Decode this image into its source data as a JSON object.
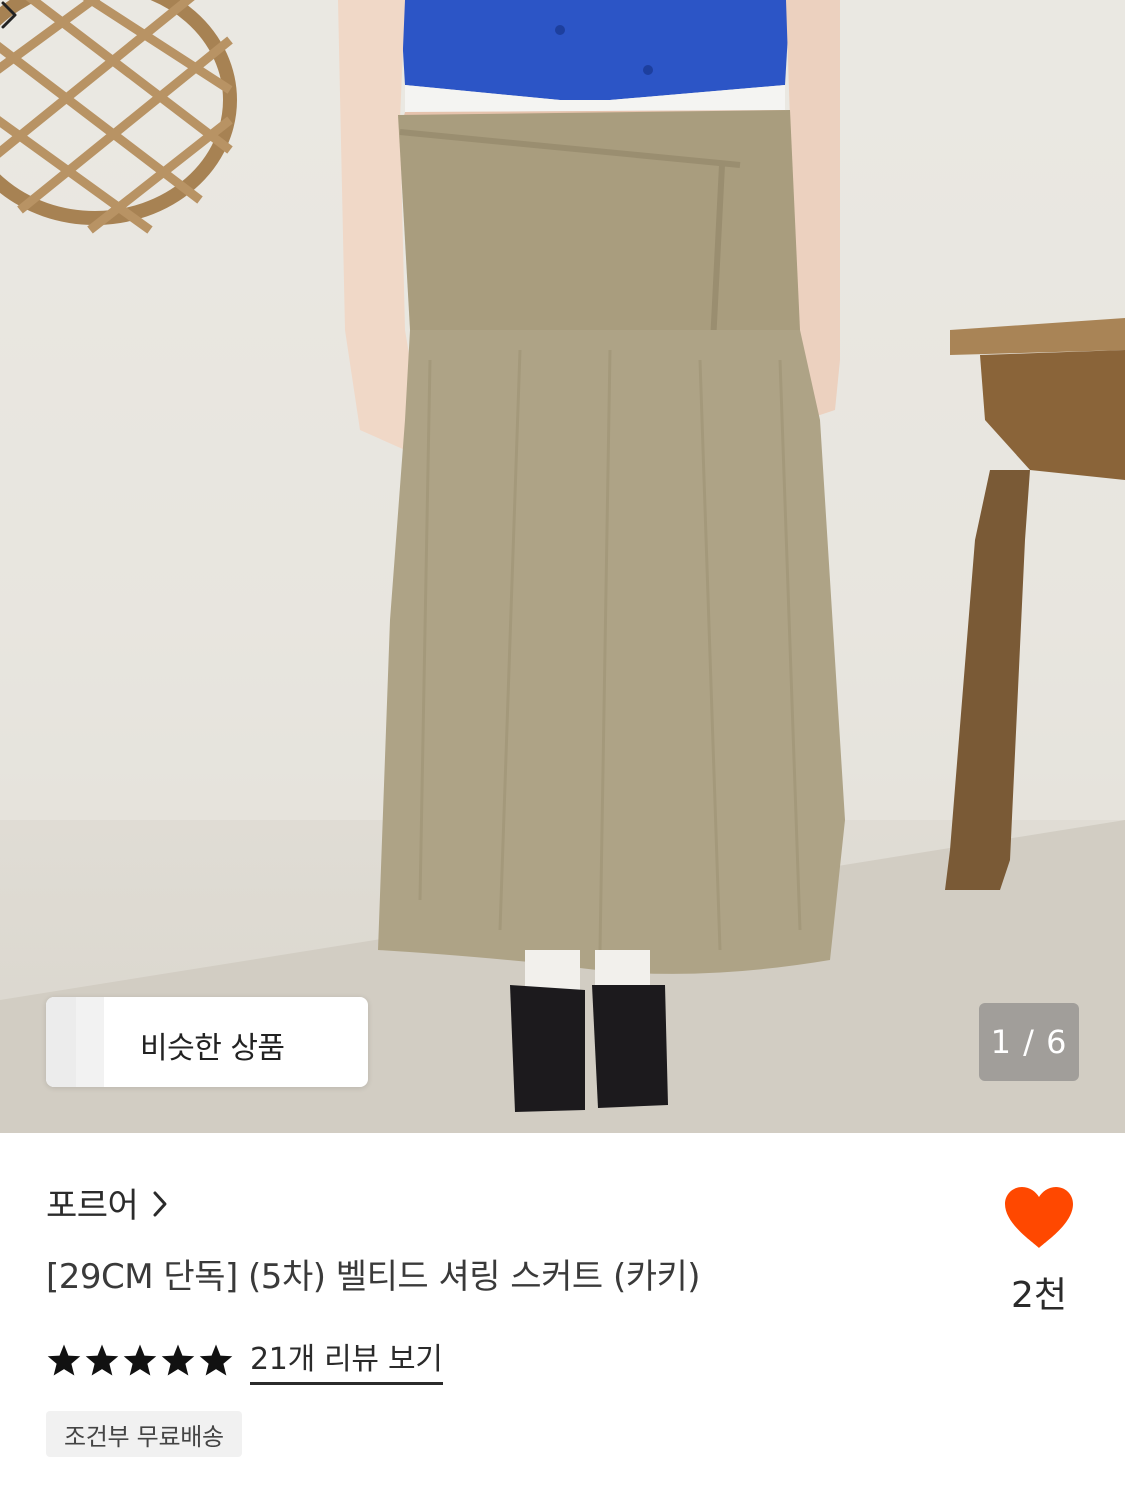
{
  "product_image": {
    "description_icon": "product-photo",
    "counter": "1 / 6"
  },
  "similar_button": {
    "label": "비슷한 상품",
    "chevron_icon": "chevron-right-icon"
  },
  "brand": {
    "name": "포르어",
    "chevron_icon": "chevron-right-icon"
  },
  "product": {
    "title": "[29CM 단독] (5차) 벨티드 셔링 스커트 (카키)"
  },
  "like": {
    "icon": "heart-icon",
    "count": "2천",
    "color": "#ff4800"
  },
  "rating": {
    "stars": 5,
    "review_link": "21개 리뷰 보기"
  },
  "shipping": {
    "badge": "조건부 무료배송"
  }
}
